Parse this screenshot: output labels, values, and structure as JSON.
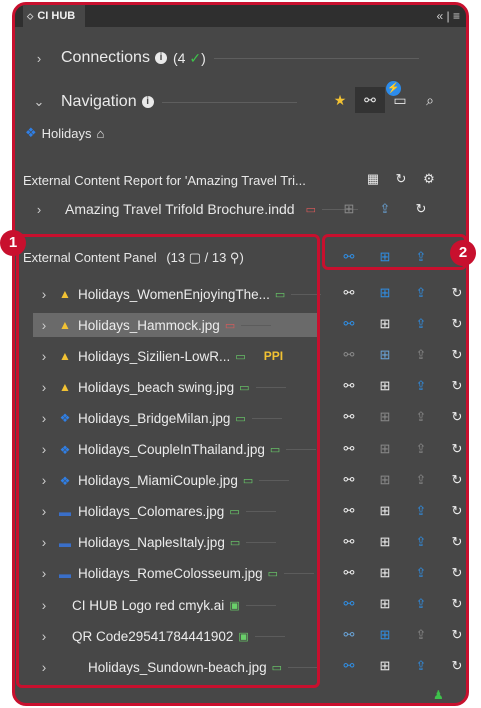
{
  "app": {
    "tab_title": "CI HUB",
    "panel_menu": "«  |  ≡"
  },
  "connections": {
    "label": "Connections",
    "count": "(4",
    "check": "✓",
    "close_paren": ")"
  },
  "navigation": {
    "label": "Navigation",
    "badge": "⚡"
  },
  "breadcrumb": {
    "label": "Holidays",
    "home_icon": "home-icon"
  },
  "report": {
    "title": "External Content Report for 'Amazing Travel Tri..."
  },
  "document": {
    "name": "Amazing Travel Trifold Brochure.indd"
  },
  "external_panel": {
    "title": "External Content Panel",
    "counts": "(13 ▢ / 13 ⚲)"
  },
  "callouts": {
    "one": "1",
    "two": "2"
  },
  "files": [
    {
      "name": "Holidays_WomenEnjoyingThe...",
      "source": "gdrive",
      "status": "green",
      "extra": ""
    },
    {
      "name": "Holidays_Hammock.jpg",
      "source": "gdrive",
      "status": "red",
      "extra": ""
    },
    {
      "name": "Holidays_Sizilien-LowR...",
      "source": "gdrive",
      "status": "green",
      "extra": "PPI"
    },
    {
      "name": "Holidays_beach swing.jpg",
      "source": "gdrive",
      "status": "green",
      "extra": ""
    },
    {
      "name": "Holidays_BridgeMilan.jpg",
      "source": "dropbox",
      "status": "green",
      "extra": ""
    },
    {
      "name": "Holidays_CoupleInThailand.jpg",
      "source": "dropbox",
      "status": "green",
      "extra": ""
    },
    {
      "name": "Holidays_MiamiCouple.jpg",
      "source": "dropbox",
      "status": "green",
      "extra": ""
    },
    {
      "name": "Holidays_Colomares.jpg",
      "source": "generic",
      "status": "green",
      "extra": ""
    },
    {
      "name": "Holidays_NaplesItaly.jpg",
      "source": "generic",
      "status": "green",
      "extra": ""
    },
    {
      "name": "Holidays_RomeColosseum.jpg",
      "source": "generic",
      "status": "green",
      "extra": ""
    },
    {
      "name": "CI HUB Logo red cmyk.ai",
      "source": "none",
      "status": "image",
      "extra": ""
    },
    {
      "name": "QR Code29541784441902",
      "source": "none",
      "status": "image",
      "extra": ""
    },
    {
      "name": "Holidays_Sundown-beach.jpg",
      "source": "none",
      "status": "green",
      "extra": ""
    }
  ],
  "colors": {
    "accent_red": "#c8102e",
    "link_blue": "#2f8fe6",
    "ok_green": "#3ec24b",
    "panel_bg": "#474747"
  }
}
